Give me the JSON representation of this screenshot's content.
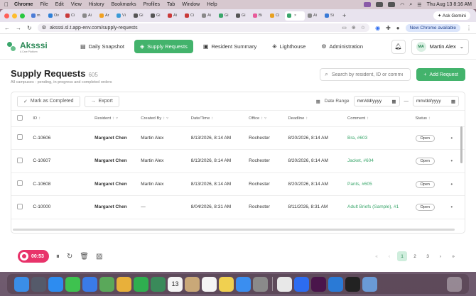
{
  "menubar": {
    "app": "Chrome",
    "items": [
      "File",
      "Edit",
      "View",
      "History",
      "Bookmarks",
      "Profiles",
      "Tab",
      "Window",
      "Help"
    ],
    "clock": "Thu Aug 13  8:16 AM"
  },
  "browser": {
    "tabs": [
      {
        "label": "m",
        "color": "#4b7bd6"
      },
      {
        "label": "Ov",
        "color": "#2e7fd6"
      },
      {
        "label": "Ci",
        "color": "#c93a3a"
      },
      {
        "label": "Ai",
        "color": "#888888"
      },
      {
        "label": "Ar",
        "color": "#f0a020"
      },
      {
        "label": "Vi",
        "color": "#3a9ad6"
      },
      {
        "label": "Gi",
        "color": "#555555"
      },
      {
        "label": "Gi",
        "color": "#555555"
      },
      {
        "label": "Ai",
        "color": "#c93a3a"
      },
      {
        "label": "Ci",
        "color": "#c93a3a"
      },
      {
        "label": "Ai",
        "color": "#888888"
      },
      {
        "label": "Gi",
        "color": "#3aa66b"
      },
      {
        "label": "Gi",
        "color": "#555555"
      },
      {
        "label": "Bi",
        "color": "#e85a9a"
      },
      {
        "label": "Ci",
        "color": "#e8a020"
      },
      {
        "label": "",
        "color": "#3aa66b",
        "active": true
      },
      {
        "label": "Ai",
        "color": "#888888"
      },
      {
        "label": "Si",
        "color": "#3a7ad6"
      }
    ],
    "ask_label": "Ask Gemini",
    "url": "aksssi.sl.t.app-env.com/supply-requests",
    "new_chrome_label": "New Chrome available"
  },
  "app": {
    "logo": "Aksssi",
    "logo_sub": "A Care Platform",
    "nav": [
      {
        "label": "Daily Snapshot",
        "icon": "▤",
        "active": false
      },
      {
        "label": "Supply Requests",
        "icon": "◈",
        "active": true
      },
      {
        "label": "Resident Summary",
        "icon": "▣",
        "active": false
      },
      {
        "label": "Lighthouse",
        "icon": "⛯",
        "active": false
      },
      {
        "label": "Administration",
        "icon": "⚙",
        "active": false
      }
    ],
    "user": {
      "initials": "MA",
      "name": "Martin Alex"
    }
  },
  "page": {
    "title": "Supply Requests",
    "count": "605",
    "subtitle": "All campuses - pending, in-progress and completed orders",
    "search_placeholder": "Search by resident, ID or comment",
    "add_label": "Add Request",
    "mark_completed_label": "Mark as Completed",
    "export_label": "Export",
    "date_range_label": "Date Range",
    "date_from": "mm/dd/yyyy",
    "date_sep": "—",
    "date_to": "mm/dd/yyyy"
  },
  "table": {
    "columns": [
      "ID",
      "Resident",
      "Created By",
      "Date/Time",
      "Office",
      "Deadline",
      "Comment",
      "Status"
    ],
    "rows": [
      {
        "id": "C-10606",
        "resident": "Margaret Chen",
        "created_by": "Martin Alex",
        "datetime": "8/13/2026, 8:14 AM",
        "office": "Rochester",
        "deadline": "8/20/2026, 8:14 AM",
        "comment": "Bra, #603",
        "status": "Open"
      },
      {
        "id": "C-10607",
        "resident": "Margaret Chen",
        "created_by": "Martin Alex",
        "datetime": "8/13/2026, 8:14 AM",
        "office": "Rochester",
        "deadline": "8/20/2026, 8:14 AM",
        "comment": "Jacket, #604",
        "status": "Open"
      },
      {
        "id": "C-10608",
        "resident": "Margaret Chen",
        "created_by": "Martin Alex",
        "datetime": "8/13/2026, 8:14 AM",
        "office": "Rochester",
        "deadline": "8/20/2026, 8:14 AM",
        "comment": "Pants, #605",
        "status": "Open"
      },
      {
        "id": "C-10000",
        "resident": "Margaret Chen",
        "created_by": "—",
        "datetime": "8/04/2026, 8:31 AM",
        "office": "Rochester",
        "deadline": "8/11/2026, 8:31 AM",
        "comment": "Adult Briefs (Sample), #1",
        "status": "Open"
      }
    ]
  },
  "recorder": {
    "time": "00:53"
  },
  "pagination": {
    "pages": [
      "1",
      "2",
      "3"
    ],
    "current": "1"
  },
  "dock": {
    "icons": [
      {
        "name": "finder-icon",
        "color": "#3a8ee8"
      },
      {
        "name": "launchpad-icon",
        "color": "#555a6a"
      },
      {
        "name": "safari-icon",
        "color": "#2d8cf0"
      },
      {
        "name": "messages-icon",
        "color": "#3ec24f"
      },
      {
        "name": "mail-icon",
        "color": "#3a7be8"
      },
      {
        "name": "maps-icon",
        "color": "#5aa85a"
      },
      {
        "name": "photos-icon",
        "color": "#e8b03a"
      },
      {
        "name": "facetime-icon",
        "color": "#2fae4f"
      },
      {
        "name": "phone-icon",
        "color": "#3a8a5a"
      },
      {
        "name": "calendar-icon",
        "color": "#f4f4f4"
      },
      {
        "name": "contacts-icon",
        "color": "#c9a878"
      },
      {
        "name": "reminders-icon",
        "color": "#f4f4f4"
      },
      {
        "name": "notes-icon",
        "color": "#f0d050"
      },
      {
        "name": "appstore-icon",
        "color": "#3a8ef0"
      },
      {
        "name": "settings-icon",
        "color": "#8a8a8a"
      },
      {
        "name": "chrome-icon",
        "color": "#e8e8e8"
      },
      {
        "name": "zoom-icon",
        "color": "#2d6cf0"
      },
      {
        "name": "slack-icon",
        "color": "#4a154b"
      },
      {
        "name": "vscode-icon",
        "color": "#2a7ad6"
      },
      {
        "name": "terminal-icon",
        "color": "#222222"
      },
      {
        "name": "preview-icon",
        "color": "#6a9ad6"
      }
    ],
    "calendar_day": "13"
  }
}
